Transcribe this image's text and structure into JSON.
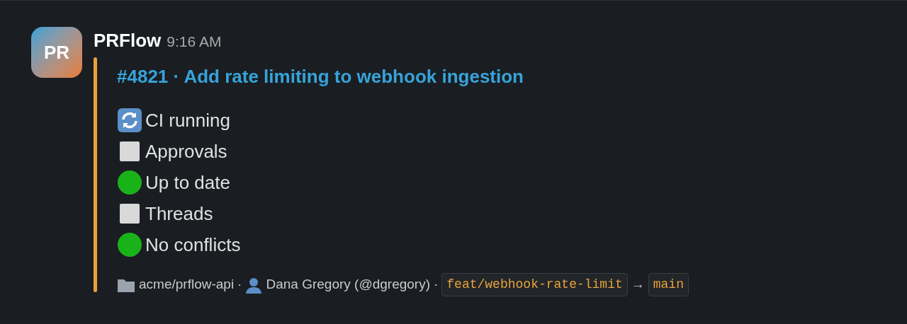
{
  "message": {
    "avatar": "PR",
    "author": "PRFlow",
    "time": "9:16 AM",
    "title": "#4821 · Add rate limiting to webhook ingestion",
    "checks": [
      {
        "kind": "running",
        "label": "CI running"
      },
      {
        "kind": "pending",
        "label": "Approvals"
      },
      {
        "kind": "passed",
        "label": "Up to date"
      },
      {
        "kind": "pending",
        "label": "Threads"
      },
      {
        "kind": "passed",
        "label": "No conflicts"
      }
    ],
    "footer": {
      "repo": "acme/prflow-api",
      "separator_1": "·",
      "user": "Dana Gregory (@dgregory)",
      "separator_2": "·",
      "source_branch": "feat/webhook-rate-limit",
      "arrow": "→",
      "target_branch": "main"
    }
  }
}
